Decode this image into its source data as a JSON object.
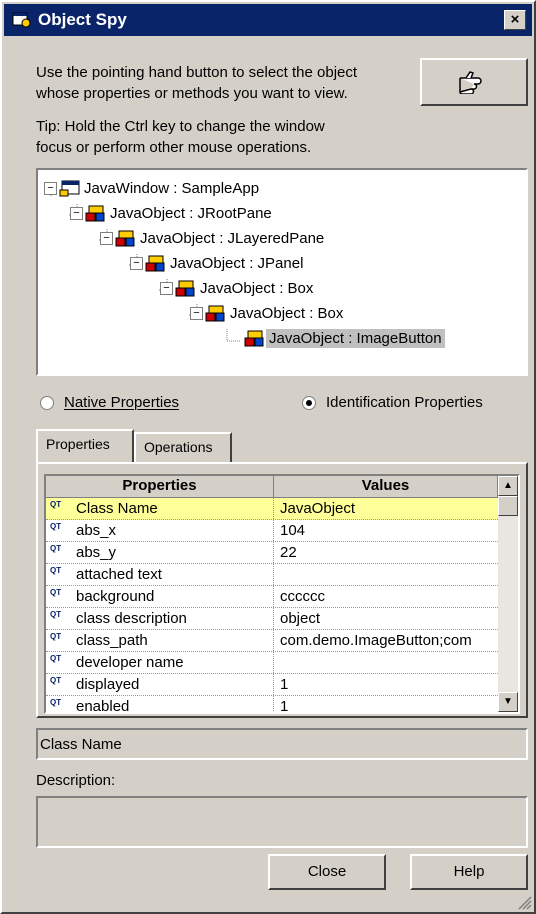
{
  "window": {
    "title": "Object Spy",
    "close_glyph": "×"
  },
  "instructions": {
    "line1": "Use the pointing hand button to select the object",
    "line2": "whose properties or methods you want to view.",
    "tip1": "Tip: Hold the Ctrl key to change the window",
    "tip2": "focus or perform other mouse operations."
  },
  "pointer_button": {
    "icon": "pointing-hand-icon"
  },
  "tree": {
    "nodes": [
      {
        "label": "JavaWindow : SampleApp",
        "icon": "java-window-icon",
        "expanded": "−"
      },
      {
        "label": "JavaObject : JRootPane",
        "icon": "java-object-icon",
        "expanded": "−"
      },
      {
        "label": "JavaObject : JLayeredPane",
        "icon": "java-object-icon",
        "expanded": "−"
      },
      {
        "label": "JavaObject : JPanel",
        "icon": "java-object-icon",
        "expanded": "−"
      },
      {
        "label": "JavaObject : Box",
        "icon": "java-object-icon",
        "expanded": "−"
      },
      {
        "label": "JavaObject : Box",
        "icon": "java-object-icon",
        "expanded": "−"
      },
      {
        "label": "JavaObject : ImageButton",
        "icon": "java-object-icon",
        "selected": true
      }
    ]
  },
  "radios": {
    "native": {
      "label": "Native Properties",
      "checked": false
    },
    "identification": {
      "label": "Identification Properties",
      "checked": true
    }
  },
  "tabs": {
    "properties": "Properties",
    "operations": "Operations"
  },
  "grid": {
    "headers": [
      "Properties",
      "Values"
    ],
    "icon_text": "QT",
    "rows": [
      {
        "name": "Class Name",
        "value": "JavaObject"
      },
      {
        "name": "abs_x",
        "value": "104"
      },
      {
        "name": "abs_y",
        "value": "22"
      },
      {
        "name": "attached text",
        "value": ""
      },
      {
        "name": "background",
        "value": "cccccc"
      },
      {
        "name": "class description",
        "value": "object"
      },
      {
        "name": "class_path",
        "value": "com.demo.ImageButton;com"
      },
      {
        "name": "developer name",
        "value": ""
      },
      {
        "name": "displayed",
        "value": "1"
      },
      {
        "name": "enabled",
        "value": "1"
      }
    ]
  },
  "selected_property": "Class Name",
  "description": {
    "label": "Description:",
    "text": ""
  },
  "buttons": {
    "close": "Close",
    "help": "Help"
  },
  "colors": {
    "titlebar": "#0a246a",
    "highlight_row": "#ffff99",
    "face": "#d4d0c8"
  }
}
